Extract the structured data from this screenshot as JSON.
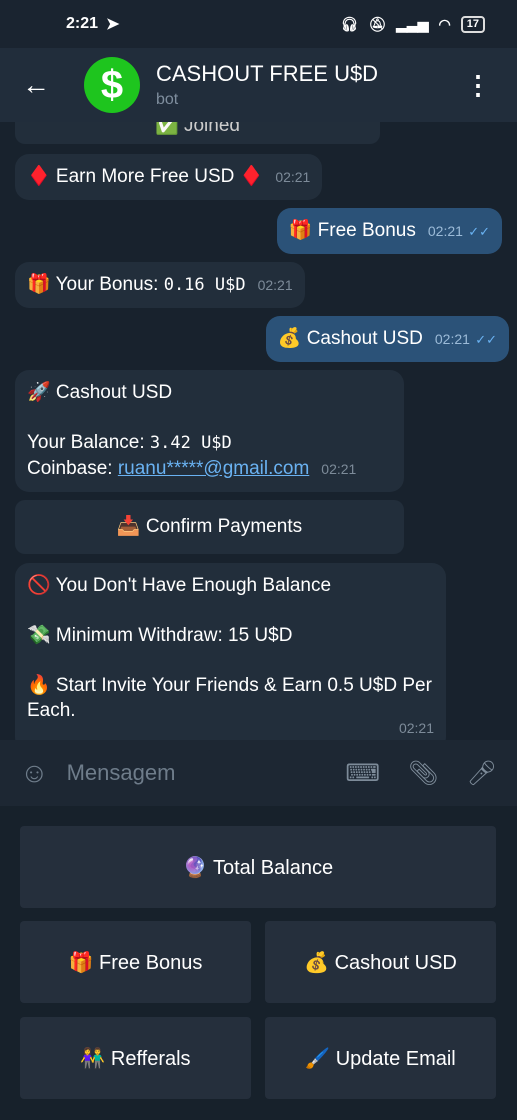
{
  "status": {
    "time": "2:21",
    "battery": "17"
  },
  "header": {
    "title": "CASHOUT FREE U$D",
    "subtitle": "bot",
    "avatar_symbol": "$"
  },
  "messages": {
    "joined": "✅ Joined",
    "earn": "♦️ Earn More Free USD ♦️",
    "earn_time": "02:21",
    "free_bonus": "🎁 Free Bonus",
    "free_bonus_time": "02:21",
    "your_bonus_label": "🎁 Your Bonus:",
    "your_bonus_value": "0.16 U$D",
    "your_bonus_time": "02:21",
    "cashout": "💰 Cashout USD",
    "cashout_time": "02:21",
    "cashout_title": "🚀 Cashout USD",
    "balance_label": "Your Balance:",
    "balance_value": "3.42 U$D",
    "coinbase_label": "Coinbase:",
    "coinbase_email": "ruanu*****@gmail.com",
    "cashout_reply_time": "02:21",
    "confirm_button": "📥 Confirm Payments",
    "no_balance": "🚫 You Don't Have Enough Balance",
    "min_label": "💸 Minimum Withdraw:",
    "min_value": "15 U$D",
    "invite": "🔥 Start Invite Your Friends & Earn 0.5 U$D Per Each.",
    "no_balance_time": "02:21"
  },
  "input": {
    "placeholder": "Mensagem"
  },
  "keyboard": {
    "total": "🔮 Total Balance",
    "free": "🎁 Free Bonus",
    "cashout": "💰 Cashout USD",
    "refs": "👫 Refferals",
    "email": "🖌️ Update Email"
  },
  "colors": {
    "accent": "#2b5278",
    "avatar": "#1ec51e",
    "link": "#6ab2f2"
  }
}
